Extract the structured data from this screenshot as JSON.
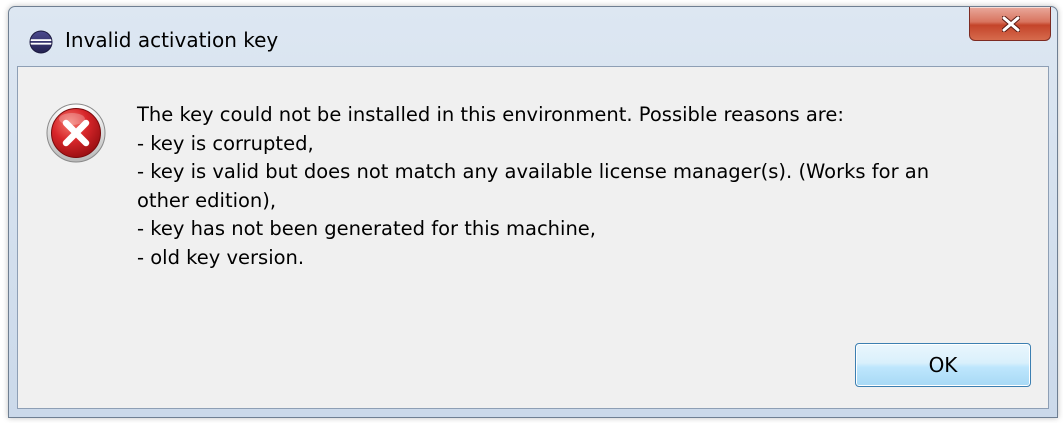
{
  "window": {
    "title": "Invalid activation key",
    "app_icon": "eclipse-icon",
    "close_icon": "close-icon"
  },
  "message": {
    "icon": "error-icon",
    "lines": [
      "The key could not be installed in this environment. Possible reasons are:",
      "- key is corrupted,",
      "- key is valid but does not match any available license manager(s). (Works for an",
      "other edition),",
      "- key has not been generated for this machine,",
      "- old key version."
    ]
  },
  "buttons": {
    "ok_label": "OK"
  },
  "colors": {
    "error_red": "#c8191c",
    "close_button_red": "#c4442a",
    "dialog_background": "#f0f0f0",
    "ok_border": "#3c7fb1"
  }
}
